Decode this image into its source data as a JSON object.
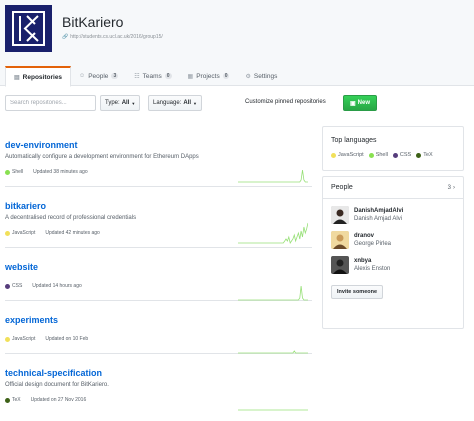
{
  "org": {
    "name": "BitKariero",
    "url": "http://students.cs.ucl.ac.uk/2016/group15/"
  },
  "tabs": [
    {
      "label": "Repositories",
      "count": "",
      "icon": "repo-icon"
    },
    {
      "label": "People",
      "count": "3",
      "icon": "person-icon"
    },
    {
      "label": "Teams",
      "count": "0",
      "icon": "team-icon"
    },
    {
      "label": "Projects",
      "count": "0",
      "icon": "project-icon"
    },
    {
      "label": "Settings",
      "count": "",
      "icon": "gear-icon"
    }
  ],
  "toolbar": {
    "search_placeholder": "Search repositories...",
    "type_label": "Type:",
    "type_value": "All",
    "language_label": "Language:",
    "language_value": "All",
    "customize_label": "Customize pinned repositories",
    "new_label": "New"
  },
  "repos": [
    {
      "name": "dev-environment",
      "description": "Automatically configure a development environment for Ethereum DApps",
      "language": "Shell",
      "language_color": "#89e051",
      "updated": "Updated 38 minutes ago",
      "activity": [
        0,
        0,
        0,
        0,
        0,
        0,
        0,
        0,
        0,
        0,
        0,
        0,
        0,
        0,
        0,
        0,
        0,
        0,
        0,
        0,
        0,
        0,
        0,
        0,
        0,
        0,
        0,
        0,
        0,
        0,
        0,
        0,
        0,
        0,
        0,
        0,
        0,
        0,
        0,
        0,
        0,
        0,
        0,
        0,
        0,
        0,
        1,
        6,
        1,
        0,
        0,
        0
      ]
    },
    {
      "name": "bitkariero",
      "description": "A decentralised record of professional credentials",
      "language": "JavaScript",
      "language_color": "#f1e05a",
      "updated": "Updated 42 minutes ago",
      "activity": [
        0,
        0,
        0,
        0,
        0,
        0,
        0,
        0,
        0,
        0,
        0,
        0,
        0,
        0,
        0,
        0,
        0,
        0,
        0,
        0,
        0,
        0,
        0,
        0,
        0,
        0,
        0,
        0,
        0,
        0,
        0,
        0,
        0,
        0,
        1,
        2,
        1,
        3,
        0,
        1,
        2,
        4,
        1,
        3,
        5,
        2,
        6,
        3,
        8,
        5,
        7,
        10
      ]
    },
    {
      "name": "website",
      "description": "",
      "language": "CSS",
      "language_color": "#563d7c",
      "updated": "Updated 14 hours ago",
      "activity": [
        0,
        0,
        0,
        0,
        0,
        0,
        0,
        0,
        0,
        0,
        0,
        0,
        0,
        0,
        0,
        0,
        0,
        0,
        0,
        0,
        0,
        0,
        0,
        0,
        0,
        0,
        0,
        0,
        0,
        0,
        0,
        0,
        0,
        0,
        0,
        0,
        0,
        0,
        0,
        0,
        0,
        0,
        0,
        0,
        0,
        1,
        7,
        1,
        0,
        0,
        0,
        0
      ]
    },
    {
      "name": "experiments",
      "description": "",
      "language": "JavaScript",
      "language_color": "#f1e05a",
      "updated": "Updated on 10 Feb",
      "activity": [
        0,
        0,
        0,
        0,
        0,
        0,
        0,
        0,
        0,
        0,
        0,
        0,
        0,
        0,
        0,
        0,
        0,
        0,
        0,
        0,
        0,
        0,
        0,
        0,
        0,
        0,
        0,
        0,
        0,
        0,
        0,
        0,
        0,
        0,
        0,
        0,
        0,
        0,
        0,
        0,
        0,
        1,
        0,
        0,
        0,
        0,
        0,
        0,
        0,
        0,
        0,
        0
      ]
    },
    {
      "name": "technical-specification",
      "description": "Official design document for BitKariero.",
      "language": "TeX",
      "language_color": "#3D6117",
      "updated": "Updated on 27 Nov 2016",
      "activity": [
        0,
        0,
        0,
        0,
        0,
        0,
        0,
        0,
        0,
        0,
        0,
        0,
        0,
        0,
        0,
        0,
        0,
        0,
        0,
        0,
        0,
        0,
        0,
        0,
        0,
        0,
        0,
        0,
        0,
        0,
        0,
        0,
        0,
        0,
        0,
        0,
        0,
        0,
        0,
        0,
        0,
        0,
        0,
        0,
        0,
        0,
        0,
        0,
        0,
        0,
        0,
        0
      ]
    }
  ],
  "sidebar": {
    "top_languages_title": "Top languages",
    "languages": [
      {
        "name": "JavaScript",
        "color": "#f1e05a"
      },
      {
        "name": "Shell",
        "color": "#89e051"
      },
      {
        "name": "CSS",
        "color": "#563d7c"
      },
      {
        "name": "TeX",
        "color": "#3D6117"
      }
    ],
    "people_title": "People",
    "people_count": "3",
    "people": [
      {
        "login": "DanishAmjadAlvi",
        "name": "Danish Amjad Alvi"
      },
      {
        "login": "dranov",
        "name": "George Pirlea"
      },
      {
        "login": "xnbya",
        "name": "Alexis Enston"
      }
    ],
    "invite_label": "Invite someone"
  },
  "colors": {
    "link": "#0366d6",
    "accent_tab": "#e36209",
    "new_button": "#28a745",
    "logo_bg": "#19206b",
    "sparkline": "#97e077"
  }
}
